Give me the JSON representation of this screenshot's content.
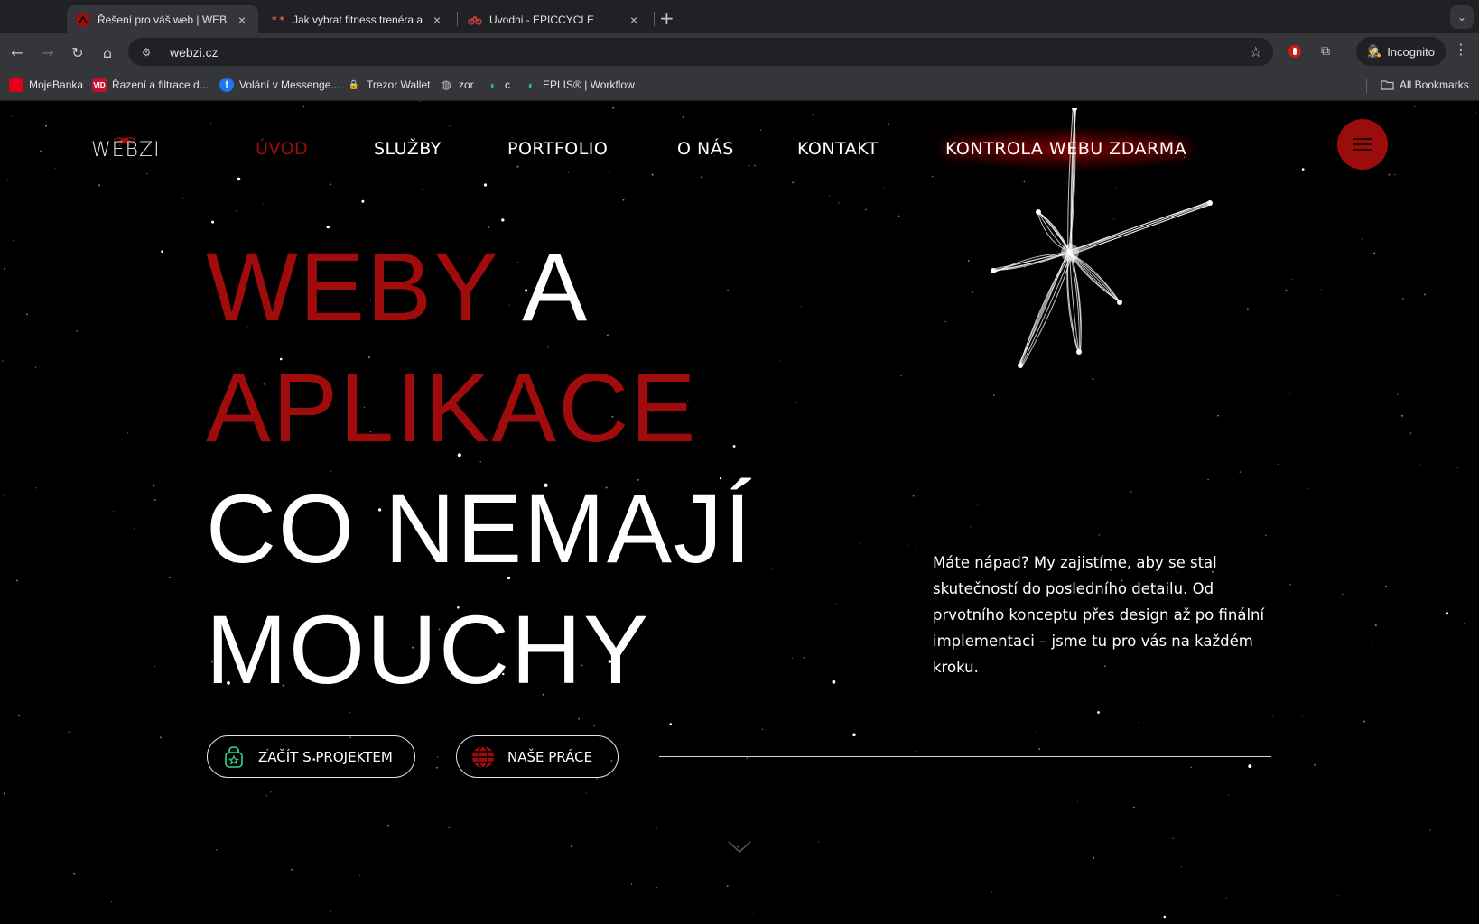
{
  "browser": {
    "tabs": [
      {
        "title": "Řešení pro váš web | WEBZI",
        "active": true,
        "close": "×"
      },
      {
        "title": "Jak vybrat fitness trenéra a na",
        "active": false,
        "close": "×"
      },
      {
        "title": "Uvodni - EPICCYCLE",
        "active": false,
        "close": "×"
      }
    ],
    "new_tab": "+",
    "address": "webzi.cz",
    "incognito_label": "Incognito",
    "bookmarks": [
      {
        "label": "MojeBanka"
      },
      {
        "label": "Řazení a filtrace d..."
      },
      {
        "label": "Volání v Messenge..."
      },
      {
        "label": "Trezor Wallet"
      },
      {
        "label": "zor"
      },
      {
        "label": "c"
      },
      {
        "label": "EPLIS® | Workflow"
      }
    ],
    "all_bookmarks": "All Bookmarks"
  },
  "site": {
    "logo": "WEBZI",
    "nav": [
      {
        "label": "ÚVOD",
        "active": true
      },
      {
        "label": "SLUŽBY"
      },
      {
        "label": "PORTFOLIO"
      },
      {
        "label": "O NÁS"
      },
      {
        "label": "KONTAKT"
      }
    ],
    "cta": "KONTROLA WEBU ZDARMA",
    "hero": {
      "line1_red": "WEBY",
      "line1_white": " A",
      "line2_red": "APLIKACE",
      "line3": "CO NEMAJÍ",
      "line4": "MOUCHY"
    },
    "lead": "Máte nápad? My zajistíme, aby se stal skutečností do posledního detailu. Od prvotního konceptu přes design až po finální implementaci – jsme tu pro vás na každém kroku.",
    "buttons": {
      "start": "ZAČÍT S PROJEKTEM",
      "work": "NAŠE PRÁCE"
    }
  },
  "colors": {
    "accent_red": "#a00c0c",
    "background": "#000000",
    "chrome_dark": "#202124",
    "chrome_mid": "#35363a"
  }
}
